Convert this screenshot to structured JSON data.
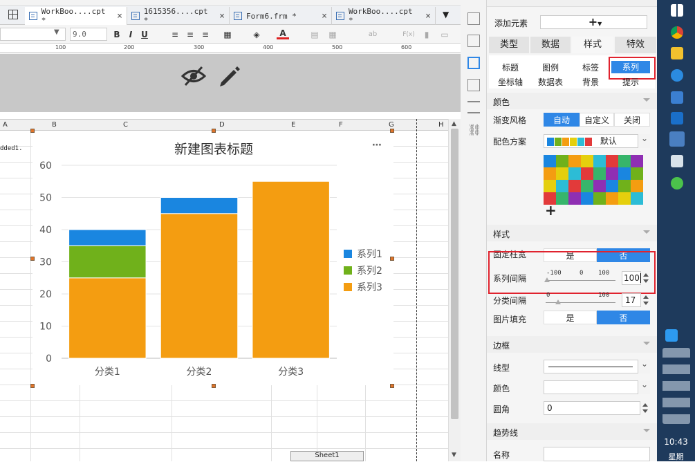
{
  "tabs": [
    {
      "label": "WorkBoo....cpt *",
      "active": true
    },
    {
      "label": "1615356....cpt *",
      "active": false
    },
    {
      "label": "Form6.frm *",
      "active": false
    },
    {
      "label": "WorkBoo....cpt *",
      "active": false
    }
  ],
  "toolbar": {
    "font_size": "9.0",
    "bold": "B",
    "italic": "I",
    "underline": "U",
    "text_color": "A",
    "formula": "F(x)",
    "ab": "ab"
  },
  "ruler": {
    "marks": [
      "100",
      "200",
      "300",
      "400",
      "500",
      "600"
    ]
  },
  "columns": [
    "A",
    "B",
    "C",
    "D",
    "E",
    "F",
    "G",
    "H"
  ],
  "cell_text": "dded1.",
  "sheet_tab": "Sheet1",
  "chart_data": {
    "type": "bar",
    "stacked": true,
    "title": "新建图表标题",
    "categories": [
      "分类1",
      "分类2",
      "分类3"
    ],
    "ylim": [
      0,
      60
    ],
    "yticks": [
      "0",
      "10",
      "20",
      "30",
      "40",
      "50",
      "60"
    ],
    "legend_position": "right",
    "series": [
      {
        "name": "系列1",
        "color": "#1a86e0",
        "values": [
          5,
          5,
          0
        ]
      },
      {
        "name": "系列2",
        "color": "#70b11b",
        "values": [
          10,
          0,
          0
        ]
      },
      {
        "name": "系列3",
        "color": "#f49d11",
        "values": [
          25,
          45,
          55
        ]
      }
    ],
    "menu_label": "⋯"
  },
  "panel": {
    "add_element": {
      "label": "添加元素",
      "value": "+"
    },
    "main_tabs": [
      "类型",
      "数据",
      "样式",
      "特效"
    ],
    "selected_main_tab": "样式",
    "sub_tabs_row1": [
      "标题",
      "图例",
      "标签",
      "系列"
    ],
    "sub_tabs_row2": [
      "坐标轴",
      "数据表",
      "背景",
      "提示"
    ],
    "selected_sub_tab": "系列",
    "color_section": "颜色",
    "gradient_label": "渐变风格",
    "gradient_options": [
      "自动",
      "自定义",
      "关闭"
    ],
    "gradient_selected": "自动",
    "scheme_label": "配色方案",
    "scheme_value": "默认",
    "add_color": "+",
    "palette": [
      "#1a86e0",
      "#70b11b",
      "#f49d11",
      "#e5cf0d",
      "#2cbcd6",
      "#e23a3a",
      "#37b56b",
      "#8f2fb3",
      "#f49d11",
      "#e5cf0d",
      "#2cbcd6",
      "#e23a3a",
      "#37b56b",
      "#8f2fb3",
      "#1a86e0",
      "#70b11b",
      "#e5cf0d",
      "#2cbcd6",
      "#e23a3a",
      "#37b56b",
      "#8f2fb3",
      "#1a86e0",
      "#70b11b",
      "#f49d11",
      "#e23a3a",
      "#37b56b",
      "#8f2fb3",
      "#1a86e0",
      "#70b11b",
      "#f49d11",
      "#e5cf0d",
      "#2cbcd6"
    ],
    "style_section": "样式",
    "fixed_width_label": "固定柱宽",
    "yes": "是",
    "no": "否",
    "series_gap_label": "系列间隔",
    "series_gap_min": "-100",
    "series_gap_mid": "0",
    "series_gap_max": "100",
    "series_gap_value": "100",
    "category_gap_label": "分类间隔",
    "category_gap_min": "0",
    "category_gap_max": "100",
    "category_gap_value": "17",
    "image_fill_label": "图片填充",
    "border_section": "边框",
    "line_type_label": "线型",
    "border_color_label": "颜色",
    "radius_label": "圆角",
    "radius_value": "0",
    "trend_section": "趋势线",
    "name_label": "名称"
  },
  "taskbar": {
    "time": "10:43",
    "day": "星期"
  }
}
